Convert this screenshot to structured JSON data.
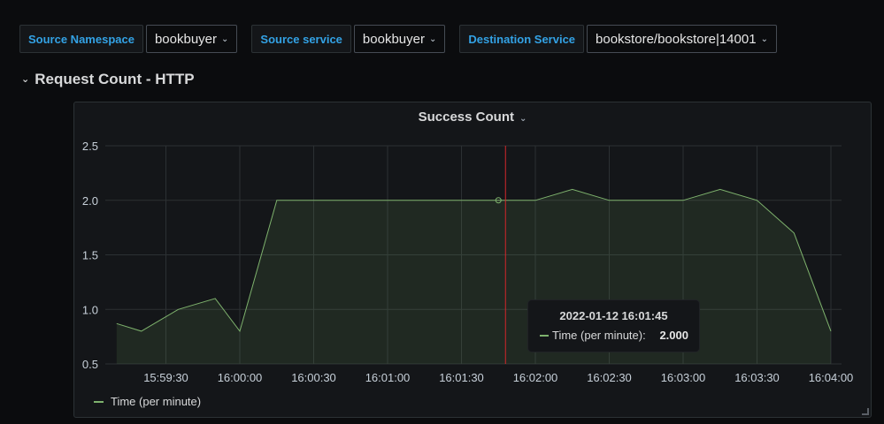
{
  "variables": [
    {
      "label": "Source Namespace",
      "value": "bookbuyer"
    },
    {
      "label": "Source service",
      "value": "bookbuyer"
    },
    {
      "label": "Destination Service",
      "value": "bookstore/bookstore|14001"
    }
  ],
  "row": {
    "title": "Request Count - HTTP",
    "icon": "chevron-down-icon"
  },
  "panel": {
    "title": "Success Count",
    "title_icon": "chevron-down-icon"
  },
  "tooltip": {
    "time": "2022-01-12 16:01:45",
    "series": "Time (per minute):",
    "value": "2.000"
  },
  "colors": {
    "series": "#7eb26d",
    "crosshair": "#d4262b",
    "accent": "#33a2e5"
  },
  "chart_data": {
    "type": "area",
    "xlabel": "",
    "ylabel": "",
    "ylim": [
      0.5,
      2.5
    ],
    "y_ticks": [
      "0.5",
      "1.0",
      "1.5",
      "2.0",
      "2.5"
    ],
    "x_ticks": [
      "15:59:30",
      "16:00:00",
      "16:00:30",
      "16:01:00",
      "16:01:30",
      "16:02:00",
      "16:02:30",
      "16:03:00",
      "16:03:30",
      "16:04:00"
    ],
    "grid": true,
    "legend_placement": "bottom-left",
    "series": [
      {
        "name": "Time (per minute)",
        "x": [
          "15:59:10",
          "15:59:20",
          "15:59:35",
          "15:59:50",
          "16:00:00",
          "16:00:15",
          "16:00:30",
          "16:00:45",
          "16:01:00",
          "16:01:15",
          "16:01:30",
          "16:01:45",
          "16:02:00",
          "16:02:15",
          "16:02:30",
          "16:02:45",
          "16:03:00",
          "16:03:15",
          "16:03:30",
          "16:03:45",
          "16:04:00"
        ],
        "values": [
          0.87,
          0.8,
          1.0,
          1.1,
          0.8,
          2.0,
          2.0,
          2.0,
          2.0,
          2.0,
          2.0,
          2.0,
          2.0,
          2.1,
          2.0,
          2.0,
          2.0,
          2.1,
          2.0,
          1.7,
          0.8
        ]
      }
    ],
    "legend": [
      "Time (per minute)"
    ],
    "hover_x": "16:01:45"
  }
}
